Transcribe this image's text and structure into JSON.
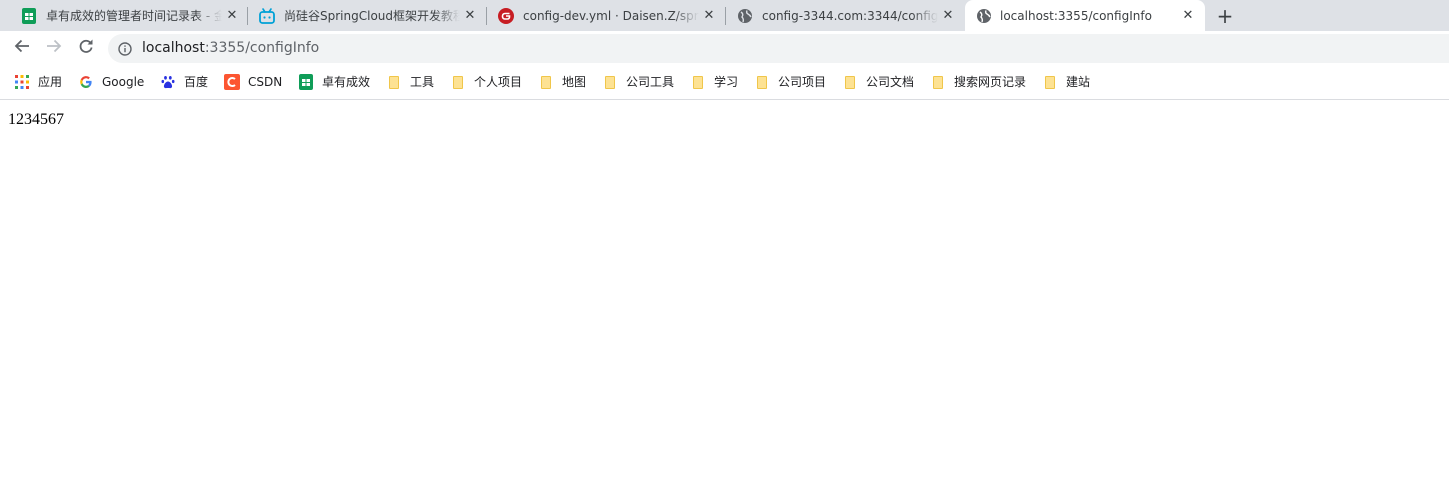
{
  "tabs": [
    {
      "title": "卓有成效的管理者时间记录表 - 金",
      "favicon": "sheets-icon",
      "active": false
    },
    {
      "title": "尚硅谷SpringCloud框架开发教程",
      "favicon": "bilibili-icon",
      "active": false
    },
    {
      "title": "config-dev.yml · Daisen.Z/spri",
      "favicon": "gitee-icon",
      "active": false
    },
    {
      "title": "config-3344.com:3344/config-",
      "favicon": "globe-icon",
      "active": false
    },
    {
      "title": "localhost:3355/configInfo",
      "favicon": "globe-icon",
      "active": true
    }
  ],
  "new_tab_label": "+",
  "close_glyph": "✕",
  "toolbar": {
    "back_icon": "back-arrow-icon",
    "forward_icon": "forward-arrow-icon",
    "reload_icon": "reload-icon",
    "url_host": "localhost",
    "url_path": ":3355/configInfo"
  },
  "bookmarks": [
    {
      "label": "应用",
      "icon": "apps-grid-icon"
    },
    {
      "label": "Google",
      "icon": "google-icon"
    },
    {
      "label": "百度",
      "icon": "baidu-icon"
    },
    {
      "label": "CSDN",
      "icon": "csdn-icon"
    },
    {
      "label": "卓有成效",
      "icon": "sheets-icon"
    },
    {
      "label": "工具",
      "icon": "folder-icon"
    },
    {
      "label": "个人项目",
      "icon": "folder-icon"
    },
    {
      "label": "地图",
      "icon": "folder-icon"
    },
    {
      "label": "公司工具",
      "icon": "folder-icon"
    },
    {
      "label": "学习",
      "icon": "folder-icon"
    },
    {
      "label": "公司项目",
      "icon": "folder-icon"
    },
    {
      "label": "公司文档",
      "icon": "folder-icon"
    },
    {
      "label": "搜索网页记录",
      "icon": "folder-icon"
    },
    {
      "label": "建站",
      "icon": "folder-icon"
    }
  ],
  "page": {
    "config_info": "1234567"
  },
  "colors": {
    "tabstrip_bg": "#dee1e6",
    "omnibox_bg": "#f1f3f4",
    "sheets_green": "#0f9d58",
    "bilibili_blue": "#00a1d6",
    "gitee_red": "#c71d23",
    "csdn_orange": "#fc5531",
    "baidu_blue": "#2932e1",
    "folder_yellow": "#fde293"
  }
}
